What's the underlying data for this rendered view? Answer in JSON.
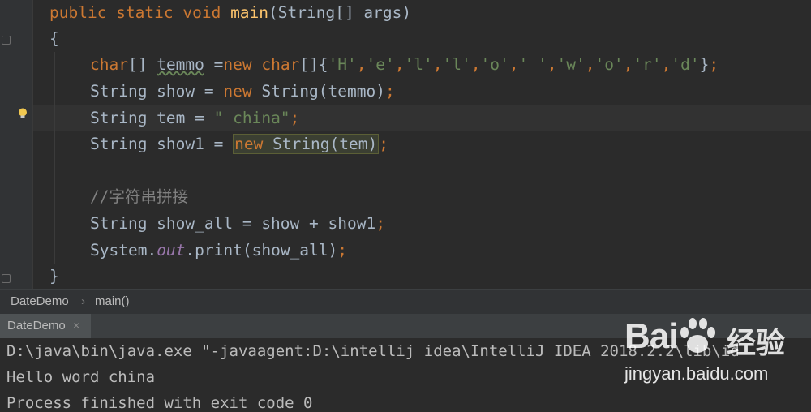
{
  "editor": {
    "lines": {
      "l1": {
        "kw1": "public static void ",
        "fn": "main",
        "rest": "(String[] args)"
      },
      "l2": {
        "text": "{"
      },
      "l3": {
        "kw1": "char",
        "a": "[] ",
        "var": "temmo",
        "b": " =",
        "kw2": "new ",
        "kw3": "char",
        "c": "[]{",
        "s1": "'H'",
        ",1": ",",
        "s2": "'e'",
        ",2": ",",
        "s3": "'l'",
        ",3": ",",
        "s4": "'l'",
        ",4": ",",
        "s5": "'o'",
        ",5": ",",
        "s6": "' '",
        ",6": ",",
        "s7": "'w'",
        ",7": ",",
        "s8": "'o'",
        ",8": ",",
        "s9": "'r'",
        ",9": ",",
        "s10": "'d'",
        "end": "}",
        ";": ";"
      },
      "l4": {
        "a": "String show = ",
        "kw": "new ",
        "b": "String(temmo)",
        "semi": ";"
      },
      "l5": {
        "a": "String tem = ",
        "str": "\" china\"",
        "semi": ";"
      },
      "l6": {
        "a": "String show1 = ",
        "kw": "new ",
        "b": "String(tem)",
        "semi": ";"
      },
      "l7": {
        "comment": "//字符串拼接"
      },
      "l8": {
        "a": "String show_all = show + show1",
        "semi": ";"
      },
      "l9": {
        "a": "System.",
        "st": "out",
        "b": ".print(show_all)",
        "semi": ";"
      },
      "l10": {
        "text": "}"
      }
    }
  },
  "breadcrumb": {
    "class_name": "DateDemo",
    "separator": "›",
    "method": "main()"
  },
  "run_tab": {
    "label": "DateDemo",
    "close": "×"
  },
  "console": {
    "line1": "D:\\java\\bin\\java.exe \"-javaagent:D:\\intellij idea\\IntelliJ IDEA 2018.2.2\\lib\\id",
    "line2": "Hello word china",
    "line3": "Process finished with exit code 0"
  },
  "watermark": {
    "logo": "Bai",
    "logo2": "du",
    "cn": "经验",
    "url": "jingyan.baidu.com"
  },
  "colors": {
    "keyword": "#cc7832",
    "method": "#ffc66d",
    "string": "#6a8759",
    "comment": "#808080",
    "static_field": "#9876aa",
    "text": "#a9b7c6",
    "background": "#2b2b2b"
  },
  "icons": {
    "gutter": "lightbulb-icon",
    "tab_close": "close-icon"
  }
}
